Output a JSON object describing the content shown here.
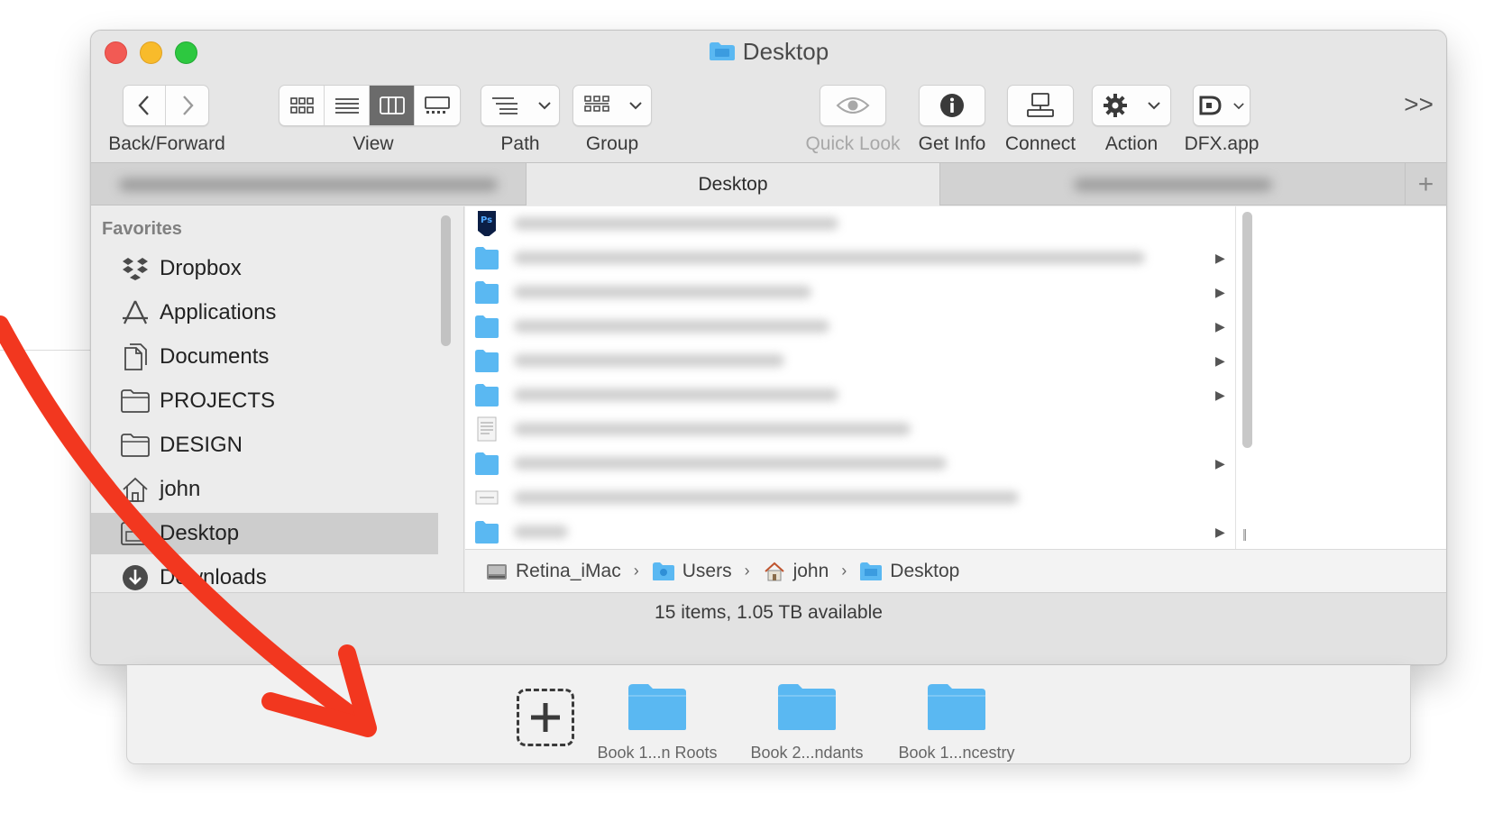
{
  "window": {
    "title": "Desktop",
    "title_icon": "folder-icon"
  },
  "toolbar": {
    "back_forward_label": "Back/Forward",
    "view_label": "View",
    "path_label": "Path",
    "group_label": "Group",
    "quick_look_label": "Quick Look",
    "get_info_label": "Get Info",
    "connect_label": "Connect",
    "action_label": "Action",
    "dfx_label": "DFX.app",
    "more_label": ">>"
  },
  "tabs": {
    "active": "Desktop",
    "add": "+"
  },
  "sidebar": {
    "heading": "Favorites",
    "items": [
      {
        "label": "Dropbox",
        "icon": "dropbox-icon"
      },
      {
        "label": "Applications",
        "icon": "applications-icon"
      },
      {
        "label": "Documents",
        "icon": "documents-icon"
      },
      {
        "label": "PROJECTS",
        "icon": "folder-icon"
      },
      {
        "label": "DESIGN",
        "icon": "folder-icon"
      },
      {
        "label": "john",
        "icon": "home-icon"
      },
      {
        "label": "Desktop",
        "icon": "desktop-icon"
      },
      {
        "label": "Downloads",
        "icon": "downloads-icon"
      }
    ]
  },
  "path": {
    "items": [
      {
        "label": "Retina_iMac",
        "icon": "disk-icon"
      },
      {
        "label": "Users",
        "icon": "users-folder-icon"
      },
      {
        "label": "john",
        "icon": "home-icon"
      },
      {
        "label": "Desktop",
        "icon": "folder-icon"
      }
    ],
    "separator": "›"
  },
  "status": {
    "text": "15 items, 1.05 TB available"
  },
  "shelf": {
    "add_symbol": "+",
    "items": [
      {
        "label": "Book 1...n Roots"
      },
      {
        "label": "Book 2...ndants"
      },
      {
        "label": "Book 1...ncestry"
      }
    ]
  },
  "colors": {
    "accent_folder": "#5ab8f2",
    "annotation_arrow": "#f2371f",
    "selection": "#cdcdcd"
  }
}
